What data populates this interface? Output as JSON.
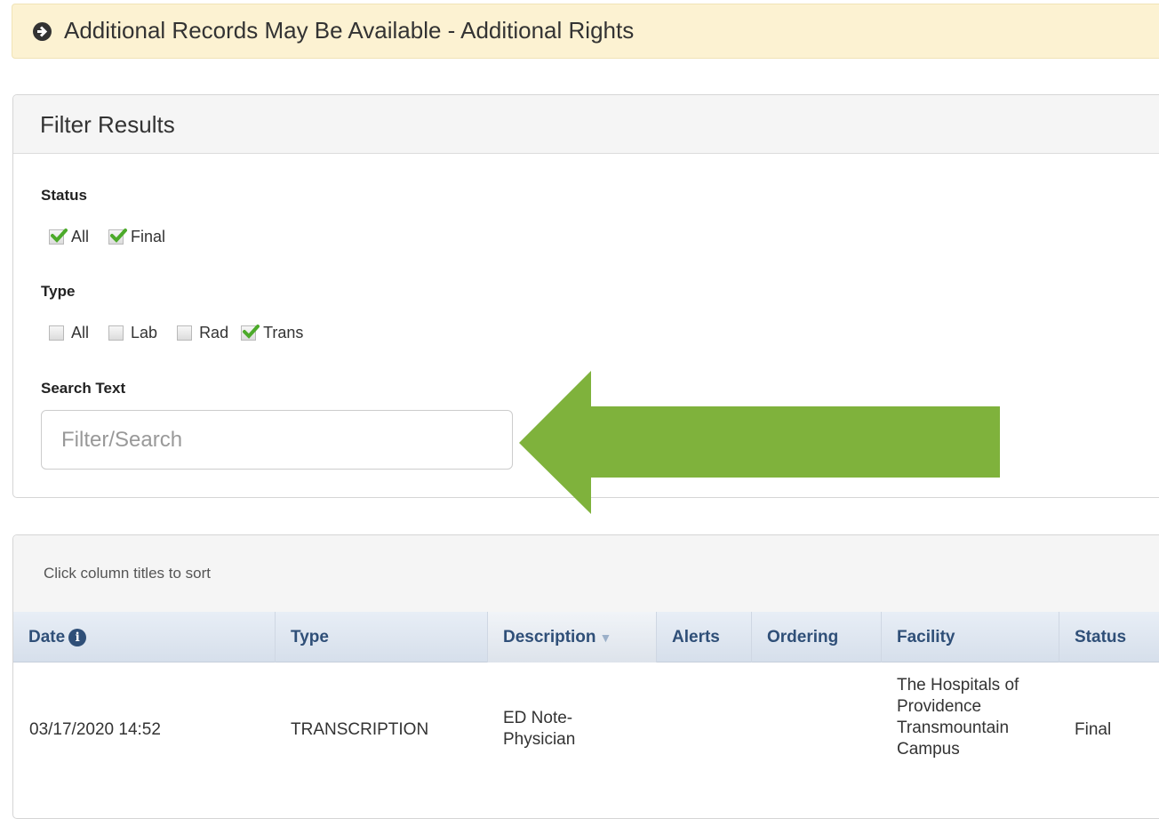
{
  "alert": {
    "text": "Additional Records May Be Available - Additional Rights",
    "icon": "arrow-circle-right-icon"
  },
  "filter": {
    "title": "Filter Results",
    "status": {
      "label": "Status",
      "options": [
        {
          "label": "All",
          "checked": true
        },
        {
          "label": "Final",
          "checked": true
        }
      ]
    },
    "type": {
      "label": "Type",
      "options": [
        {
          "label": "All",
          "checked": false
        },
        {
          "label": "Lab",
          "checked": false
        },
        {
          "label": "Rad",
          "checked": false
        },
        {
          "label": "Trans",
          "checked": true
        }
      ]
    },
    "search": {
      "label": "Search Text",
      "placeholder": "Filter/Search",
      "value": ""
    }
  },
  "annotation": {
    "color": "#7fb23c",
    "icon": "big-green-arrow-left-icon"
  },
  "results": {
    "hint": "Click column titles to sort",
    "columns": [
      {
        "label": "Date"
      },
      {
        "label": "Type"
      },
      {
        "label": "Description"
      },
      {
        "label": "Alerts"
      },
      {
        "label": "Ordering"
      },
      {
        "label": "Facility"
      },
      {
        "label": "Status"
      }
    ],
    "rows": [
      {
        "date": "03/17/2020 14:52",
        "type": "TRANSCRIPTION",
        "description": [
          "ED Note-",
          "Physician"
        ],
        "alerts": "",
        "ordering": "",
        "facility": [
          "The Hospitals of",
          "Providence",
          "Transmountain",
          "Campus"
        ],
        "status": "Final"
      }
    ]
  },
  "colors": {
    "alert_bg": "#fcf2d2",
    "header_text": "#2f4f78",
    "check_green": "#4caa2a"
  }
}
